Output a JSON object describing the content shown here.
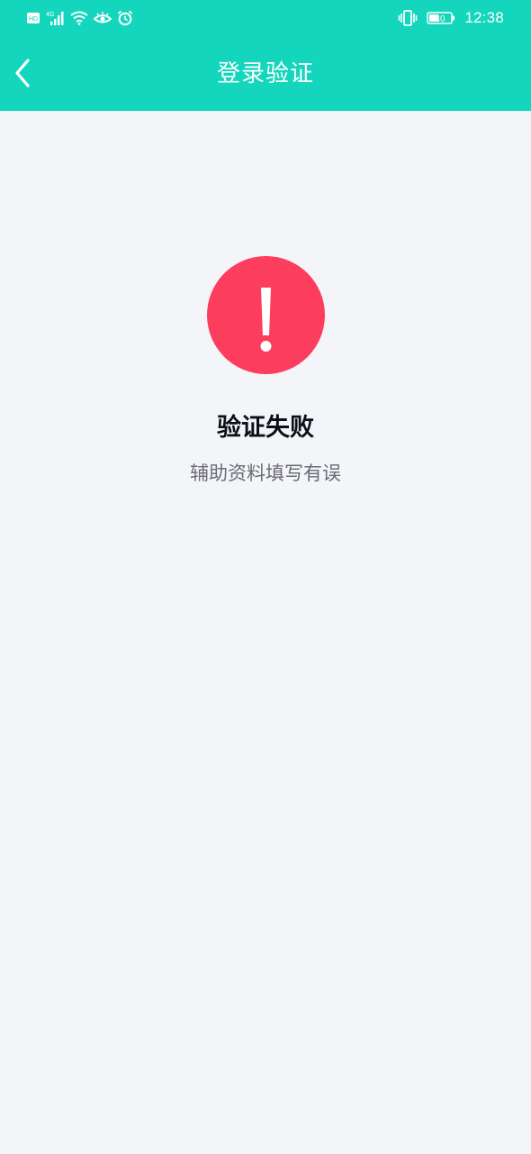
{
  "status_bar": {
    "time": "12:38",
    "battery": "40",
    "hd_label": "HD",
    "network_label": "4G"
  },
  "header": {
    "title": "登录验证"
  },
  "result": {
    "title": "验证失败",
    "message": "辅助资料填写有误"
  },
  "colors": {
    "header": "#14d6bd",
    "background": "#f4f5f9",
    "error": "#fd3d5d"
  },
  "icons": {
    "back": "chevron-left-icon",
    "error": "exclamation-icon"
  }
}
